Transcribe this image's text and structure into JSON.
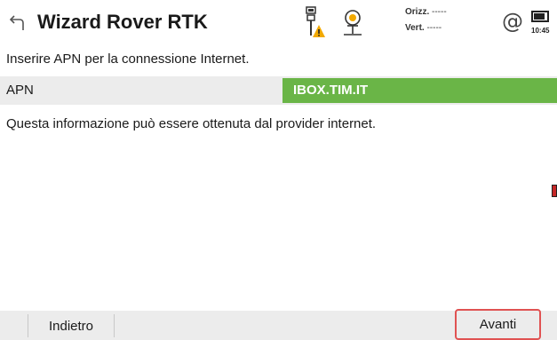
{
  "header": {
    "title": "Wizard Rover RTK",
    "accuracy": {
      "horizontal_label": "Orizz.",
      "horizontal_value": "-----",
      "vertical_label": "Vert.",
      "vertical_value": "-----"
    },
    "at_symbol": "@",
    "clock": "10:45"
  },
  "content": {
    "instruction": "Inserire APN per la connessione Internet.",
    "apn_label": "APN",
    "apn_value": "IBOX.TIM.IT",
    "info": "Questa informazione può essere ottenuta dal provider internet."
  },
  "footer": {
    "back_label": "Indietro",
    "next_label": "Avanti"
  },
  "colors": {
    "input_green": "#6ab547",
    "highlight_red": "#e05252",
    "footer_bg": "#ececec"
  },
  "icons": [
    "back-arrow-icon",
    "rover-warning-icon",
    "satellite-receiver-icon",
    "at-icon",
    "battery-icon"
  ]
}
